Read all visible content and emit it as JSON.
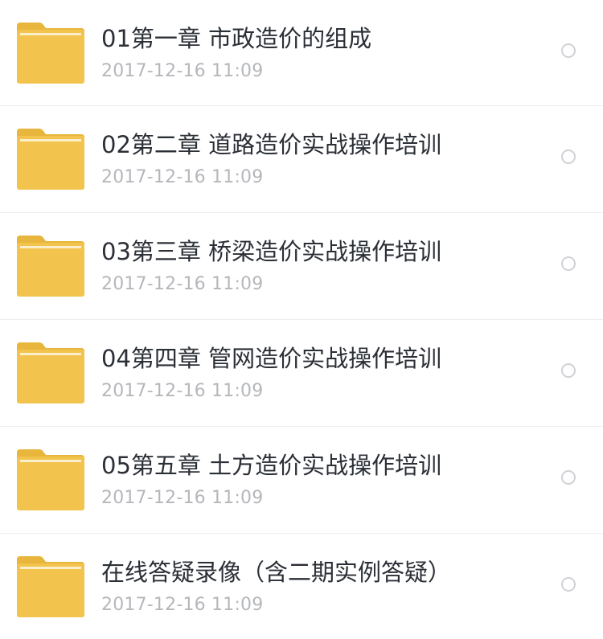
{
  "files": [
    {
      "name": "01第一章 市政造价的组成",
      "date": "2017-12-16  11:09",
      "icon": "folder-icon"
    },
    {
      "name": "02第二章 道路造价实战操作培训",
      "date": "2017-12-16  11:09",
      "icon": "folder-icon"
    },
    {
      "name": "03第三章 桥梁造价实战操作培训",
      "date": "2017-12-16  11:09",
      "icon": "folder-icon"
    },
    {
      "name": "04第四章 管网造价实战操作培训",
      "date": "2017-12-16  11:09",
      "icon": "folder-icon"
    },
    {
      "name": "05第五章 土方造价实战操作培训",
      "date": "2017-12-16  11:09",
      "icon": "folder-icon"
    },
    {
      "name": "在线答疑录像（含二期实例答疑）",
      "date": "2017-12-16  11:09",
      "icon": "folder-icon"
    }
  ],
  "colors": {
    "folder_body": "#F2C44E",
    "folder_tab": "#E8B63C",
    "folder_stripe": "#FBEFCB",
    "title_text": "#2B2F36",
    "date_text": "#B5B7BB",
    "divider": "#EEEEEE",
    "radio_border": "#CFD1D4"
  }
}
